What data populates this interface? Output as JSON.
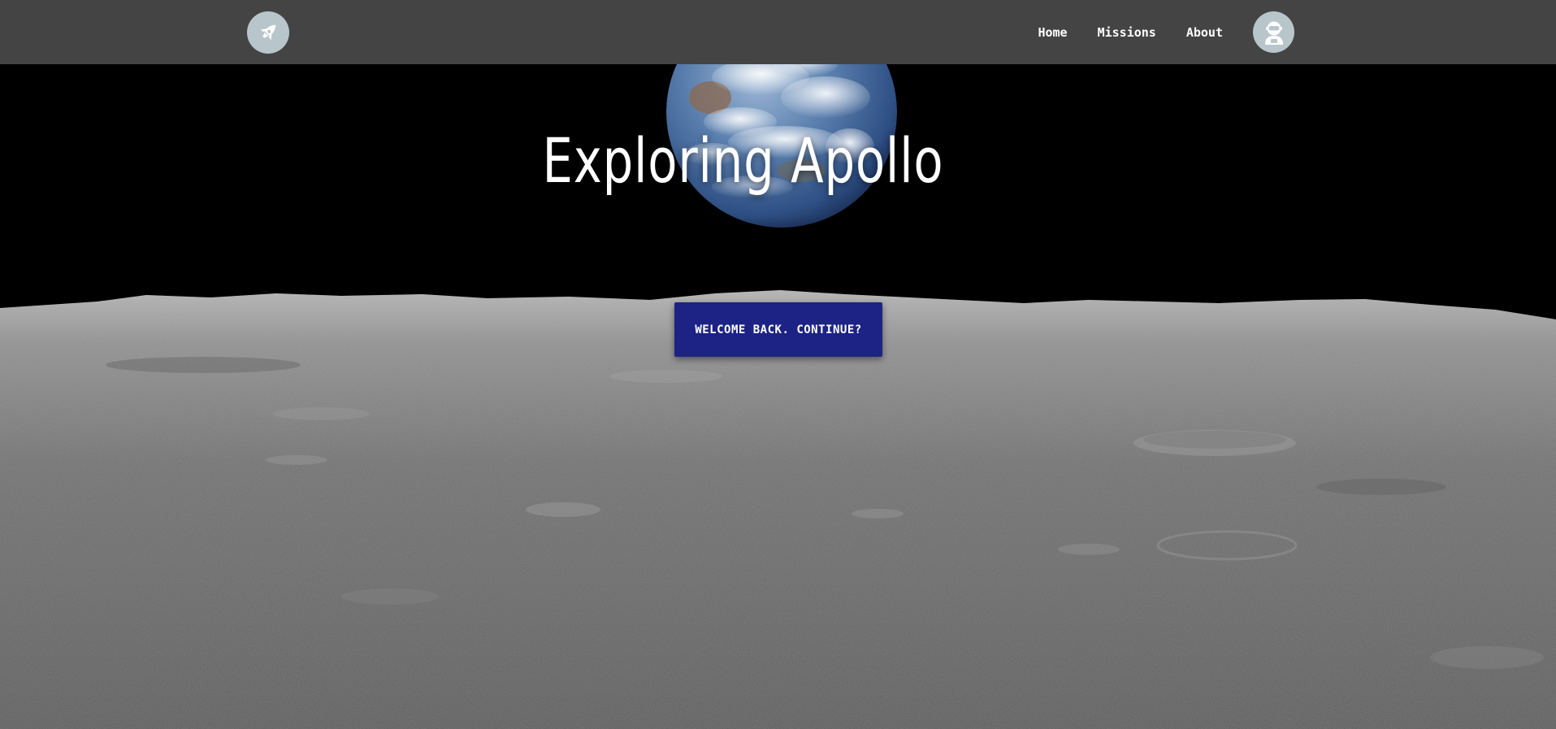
{
  "nav": {
    "logo_icon": "rocket-icon",
    "links": [
      {
        "label": "Home"
      },
      {
        "label": "Missions"
      },
      {
        "label": "About"
      }
    ],
    "avatar_icon": "astronaut-icon"
  },
  "hero": {
    "title": "Exploring Apollo",
    "cta_label": "WELCOME BACK. CONTINUE?",
    "background": "earthrise-over-lunar-horizon"
  },
  "colors": {
    "navbar": "#444444",
    "icon_circle": "#b8c6cc",
    "cta": "#1c2385"
  }
}
